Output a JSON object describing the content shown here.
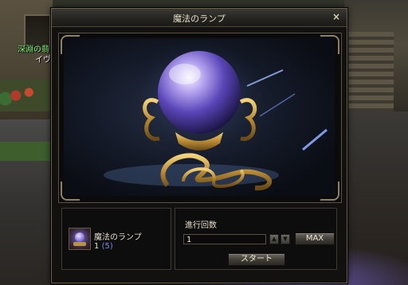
{
  "world": {
    "npc_name": "深淵の翡",
    "npc_subtitle": "イヴァ"
  },
  "dialog": {
    "title": "魔法のランプ",
    "close_label": "×"
  },
  "item": {
    "name": "魔法のランプ",
    "count": "1",
    "owned": "(5)"
  },
  "form": {
    "count_label": "進行回数",
    "count_value": "1",
    "up_glyph": "▲",
    "down_glyph": "▼",
    "max_label": "MAX",
    "start_label": "スタート"
  },
  "colors": {
    "accent_gold": "#b89540",
    "orb_purple": "#8a74d6",
    "count_blue": "#6f8ff2",
    "npc_green": "#7cf07a"
  }
}
